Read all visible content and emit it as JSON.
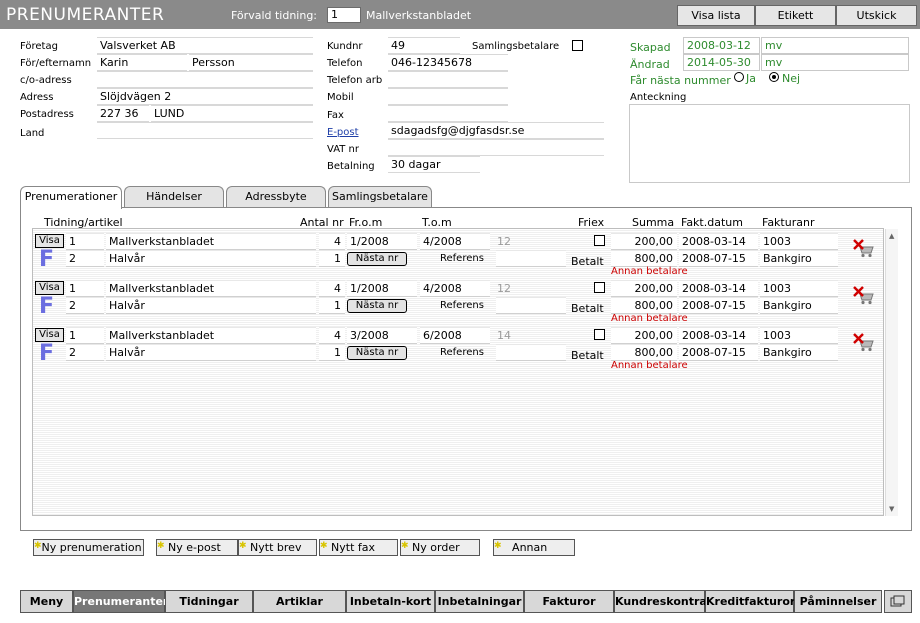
{
  "header": {
    "title": "PRENUMERANTER",
    "default_paper_label": "Förvald tidning:",
    "default_paper_num": "1",
    "default_paper_name": "Mallverkstanbladet",
    "buttons": [
      "Visa lista",
      "Etikett",
      "Utskick"
    ]
  },
  "customer": {
    "company_label": "Företag",
    "company": "Valsverket AB",
    "name_label": "För/efternamn",
    "first_name": "Karin",
    "last_name": "Persson",
    "co_label": "c/o-adress",
    "co": "",
    "address_label": "Adress",
    "address": "Slöjdvägen 2",
    "postal_label": "Postadress",
    "postal_code": "227 36",
    "city": "LUND",
    "country_label": "Land",
    "country": "",
    "kundnr_label": "Kundnr",
    "kundnr": "49",
    "samlings_label": "Samlingsbetalare",
    "phone_label": "Telefon",
    "phone": "046-12345678",
    "phone_work_label": "Telefon arb",
    "phone_work": "",
    "mobile_label": "Mobil",
    "mobile": "",
    "fax_label": "Fax",
    "fax": "",
    "email_label": "E-post",
    "email": "sdagadsfg@djgfasdsr.se",
    "vat_label": "VAT nr",
    "vat": "",
    "payment_label": "Betalning",
    "payment": "30 dagar",
    "created_label": "Skapad",
    "created_date": "2008-03-12",
    "created_by": "mv",
    "changed_label": "Ändrad",
    "changed_date": "2014-05-30",
    "changed_by": "mv",
    "next_number_label": "Får nästa nummer",
    "yes_label": "Ja",
    "no_label": "Nej",
    "notes_label": "Anteckning"
  },
  "tabs": [
    "Prenumerationer",
    "Händelser",
    "Adressbyte",
    "Samlingsbetalare"
  ],
  "columns": {
    "article": "Tidning/artikel",
    "qty": "Antal nr",
    "from": "Fr.o.m",
    "to": "T.o.m",
    "friex": "Friex",
    "sum": "Summa",
    "inv_date": "Fakt.datum",
    "inv_nr": "Fakturanr"
  },
  "row_labels": {
    "visa": "Visa",
    "next": "Nästa nr",
    "ref": "Referens",
    "paid": "Betalt",
    "other_payer": "Annan betalare",
    "f_icon": "F"
  },
  "subscriptions": [
    {
      "nr": "1",
      "article": "Mallverkstanbladet",
      "qty": "4",
      "from": "1/2008",
      "to": "4/2008",
      "issues": "12",
      "sum": "200,00",
      "inv_date": "2008-03-14",
      "inv_nr": "1003",
      "nr2": "2",
      "plan": "Halvår",
      "qty2": "1",
      "paid_sum": "800,00",
      "paid_date": "2008-07-15",
      "paid_via": "Bankgiro"
    },
    {
      "nr": "1",
      "article": "Mallverkstanbladet",
      "qty": "4",
      "from": "1/2008",
      "to": "4/2008",
      "issues": "12",
      "sum": "200,00",
      "inv_date": "2008-03-14",
      "inv_nr": "1003",
      "nr2": "2",
      "plan": "Halvår",
      "qty2": "1",
      "paid_sum": "800,00",
      "paid_date": "2008-07-15",
      "paid_via": "Bankgiro"
    },
    {
      "nr": "1",
      "article": "Mallverkstanbladet",
      "qty": "4",
      "from": "3/2008",
      "to": "6/2008",
      "issues": "14",
      "sum": "200,00",
      "inv_date": "2008-03-14",
      "inv_nr": "1003",
      "nr2": "2",
      "plan": "Halvår",
      "qty2": "1",
      "paid_sum": "800,00",
      "paid_date": "2008-07-15",
      "paid_via": "Bankgiro"
    }
  ],
  "actions": [
    "Ny prenumeration",
    "Ny e-post",
    "Nytt brev",
    "Nytt fax",
    "Ny order",
    "Annan"
  ],
  "nav": [
    "Meny",
    "Prenumeranter",
    "Tidningar",
    "Artiklar",
    "Inbetaln-kort",
    "Inbetalningar",
    "Fakturor",
    "Kundreskontra",
    "Kreditfakturor",
    "Påminnelser"
  ],
  "nav_active": "Prenumeranter",
  "colors": {
    "titlebar": "#8a8a8a",
    "green": "#2e8b2e",
    "red": "#cc0000",
    "f_icon": "#6b6ee0",
    "nav_active": "#777777"
  }
}
